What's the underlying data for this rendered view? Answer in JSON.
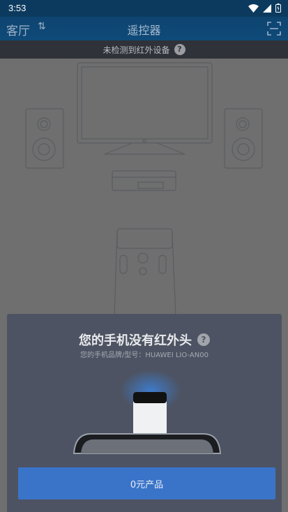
{
  "status_bar": {
    "time": "3:53"
  },
  "app_bar": {
    "room": "客厅",
    "title": "遥控器"
  },
  "notice": {
    "text": "未检测到红外设备",
    "help": "?"
  },
  "dialog": {
    "heading": "您的手机没有红外头",
    "help": "?",
    "model": "您的手机品牌/型号：HUAWEI LIO-AN00",
    "button_label": "0元产品"
  }
}
